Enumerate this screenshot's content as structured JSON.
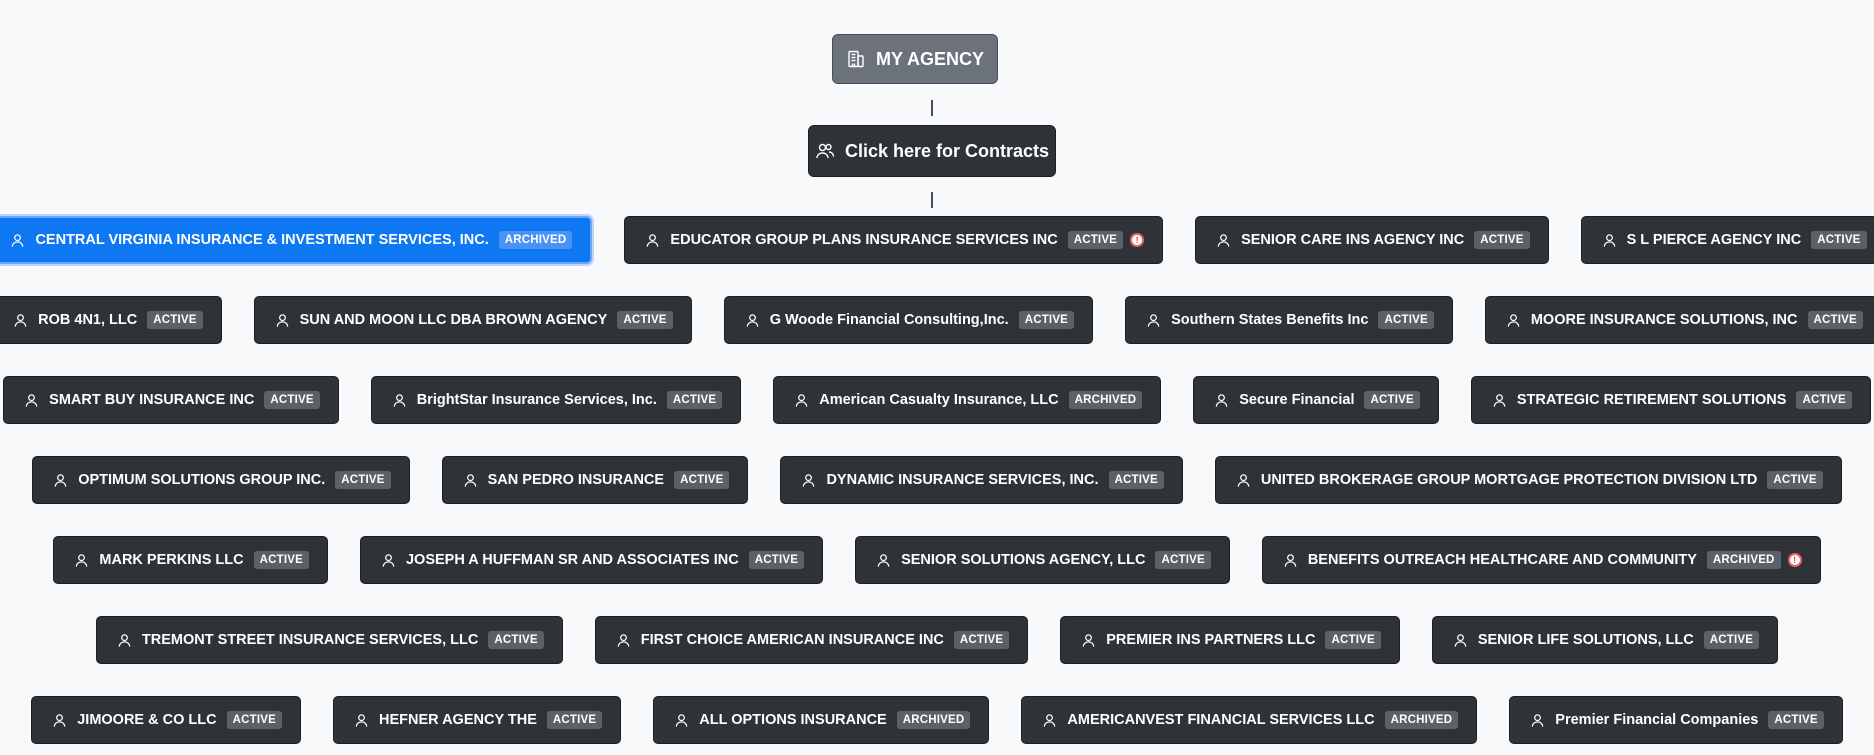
{
  "root": {
    "label": "MY AGENCY",
    "icon": "building-icon"
  },
  "contracts": {
    "label": "Click here for Contracts",
    "icon": "users-icon"
  },
  "alert_glyph": "!",
  "rows": [
    [
      {
        "name": "CENTRAL VIRGINIA INSURANCE & INVESTMENT SERVICES, INC.",
        "status": "ARCHIVED",
        "selected": true
      },
      {
        "name": "EDUCATOR GROUP PLANS INSURANCE SERVICES INC",
        "status": "ACTIVE",
        "alert": true
      },
      {
        "name": "SENIOR CARE INS AGENCY INC",
        "status": "ACTIVE"
      },
      {
        "name": "S L PIERCE AGENCY INC",
        "status": "ACTIVE"
      }
    ],
    [
      {
        "name": "ROB 4N1, LLC",
        "status": "ACTIVE"
      },
      {
        "name": "SUN AND MOON LLC DBA BROWN AGENCY",
        "status": "ACTIVE"
      },
      {
        "name": "G Woode Financial Consulting,Inc.",
        "status": "ACTIVE"
      },
      {
        "name": "Southern States Benefits Inc",
        "status": "ACTIVE"
      },
      {
        "name": "MOORE INSURANCE SOLUTIONS, INC",
        "status": "ACTIVE"
      }
    ],
    [
      {
        "name": "SMART BUY INSURANCE INC",
        "status": "ACTIVE"
      },
      {
        "name": "BrightStar Insurance Services, Inc.",
        "status": "ACTIVE"
      },
      {
        "name": "American Casualty Insurance, LLC",
        "status": "ARCHIVED"
      },
      {
        "name": "Secure Financial",
        "status": "ACTIVE"
      },
      {
        "name": "STRATEGIC RETIREMENT SOLUTIONS",
        "status": "ACTIVE"
      }
    ],
    [
      {
        "name": "OPTIMUM SOLUTIONS GROUP INC.",
        "status": "ACTIVE"
      },
      {
        "name": "SAN PEDRO INSURANCE",
        "status": "ACTIVE"
      },
      {
        "name": "DYNAMIC INSURANCE SERVICES, INC.",
        "status": "ACTIVE"
      },
      {
        "name": "UNITED BROKERAGE GROUP MORTGAGE PROTECTION DIVISION LTD",
        "status": "ACTIVE"
      }
    ],
    [
      {
        "name": "MARK PERKINS LLC",
        "status": "ACTIVE"
      },
      {
        "name": "JOSEPH A HUFFMAN SR AND ASSOCIATES INC",
        "status": "ACTIVE"
      },
      {
        "name": "SENIOR SOLUTIONS AGENCY, LLC",
        "status": "ACTIVE"
      },
      {
        "name": "BENEFITS OUTREACH HEALTHCARE AND COMMUNITY",
        "status": "ARCHIVED",
        "alert": true
      }
    ],
    [
      {
        "name": "TREMONT STREET INSURANCE SERVICES, LLC",
        "status": "ACTIVE"
      },
      {
        "name": "FIRST CHOICE AMERICAN INSURANCE INC",
        "status": "ACTIVE"
      },
      {
        "name": "PREMIER INS PARTNERS LLC",
        "status": "ACTIVE"
      },
      {
        "name": "SENIOR LIFE SOLUTIONS, LLC",
        "status": "ACTIVE"
      }
    ],
    [
      {
        "name": "JIMOORE & CO LLC",
        "status": "ACTIVE"
      },
      {
        "name": "HEFNER AGENCY THE",
        "status": "ACTIVE"
      },
      {
        "name": "ALL OPTIONS INSURANCE",
        "status": "ARCHIVED"
      },
      {
        "name": "AMERICANVEST FINANCIAL SERVICES LLC",
        "status": "ARCHIVED"
      },
      {
        "name": "Premier Financial Companies",
        "status": "ACTIVE"
      }
    ]
  ]
}
